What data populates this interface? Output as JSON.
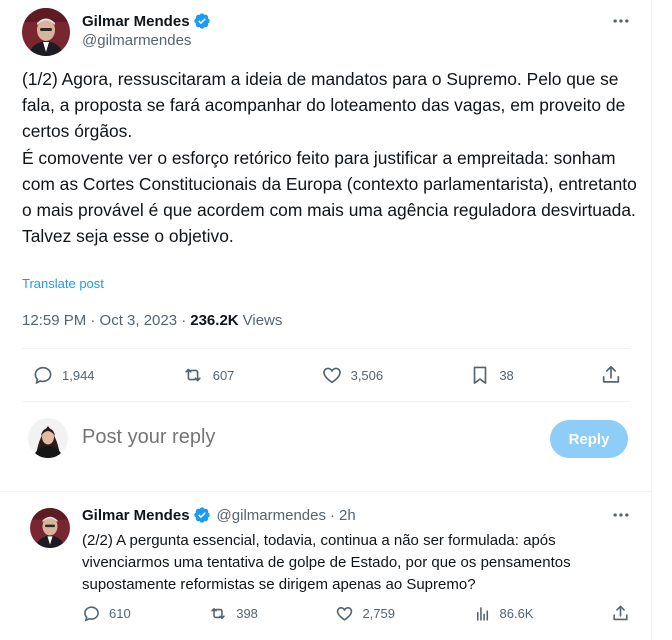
{
  "tweet": {
    "author_name": "Gilmar Mendes",
    "author_handle": "@gilmarmendes",
    "lines": [
      "(1/2) Agora, ressuscitaram a ideia de mandatos para o Supremo. Pelo que se fala, a proposta se fará acompanhar do loteamento das vagas, em proveito de certos órgãos.",
      "É comovente ver o esforço retórico feito para justificar a empreitada: sonham com as Cortes Constitucionais da Europa (contexto parlamentarista), entretanto o mais provável é que acordem com mais uma agência reguladora desvirtuada.",
      "Talvez seja esse o objetivo."
    ],
    "translate_label": "Translate post",
    "timestamp": "12:59 PM · Oct 3, 2023 · ",
    "views_count": "236.2K",
    "views_label": "Views",
    "replies": "1,944",
    "reposts": "607",
    "likes": "3,506",
    "bookmarks": "38"
  },
  "reply_composer": {
    "placeholder": "Post your reply",
    "button_label": "Reply"
  },
  "second_tweet": {
    "author_name": "Gilmar Mendes",
    "author_handle": "@gilmarmendes",
    "separator": "·",
    "time": "2h",
    "text": "(2/2) A pergunta essencial, todavia, continua a não ser formulada: após vivenciarmos uma tentativa de golpe de Estado, por que os pensamentos supostamente reformistas se dirigem apenas ao Supremo?",
    "replies": "610",
    "reposts": "398",
    "likes": "2,759",
    "views": "86.6K"
  },
  "icons": {
    "verified": "verified-badge-icon",
    "more": "more-horizontal-icon",
    "reply": "reply-icon",
    "repost": "repost-icon",
    "like": "heart-icon",
    "bookmark": "bookmark-icon",
    "share": "share-icon",
    "views": "analytics-icon"
  },
  "colors": {
    "accent": "#1d9bf0",
    "reply_button_disabled": "#8ecdf8",
    "secondary_text": "#536471",
    "primary_text": "#0f1419"
  }
}
